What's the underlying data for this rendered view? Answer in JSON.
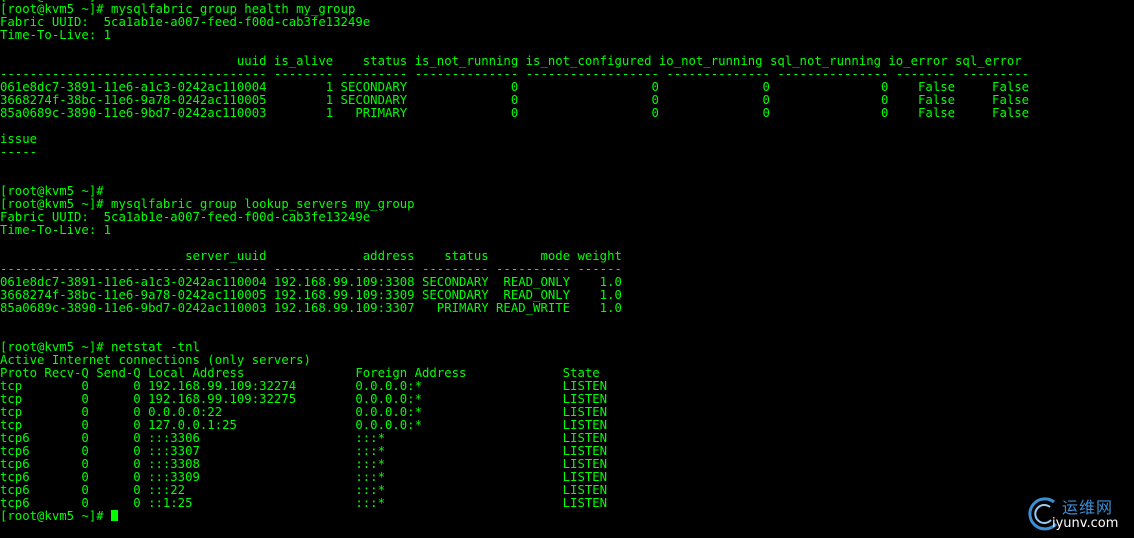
{
  "terminal": {
    "fg_color": "#00ff00",
    "bg_color": "#000000",
    "lines": [
      "[root@kvm5 ~]#",
      "[root@kvm5 ~]# mysqlfabric group health my_group",
      "Fabric UUID:  5ca1ab1e-a007-feed-f00d-cab3fe13249e",
      "Time-To-Live: 1",
      "",
      "                                uuid is_alive    status is_not_running is_not_configured io_not_running sql_not_running io_error sql_error",
      "------------------------------------ -------- --------- -------------- ------------------ -------------- --------------- -------- ---------",
      "061e8dc7-3891-11e6-a1c3-0242ac110004        1 SECONDARY              0                  0              0               0    False     False",
      "3668274f-38bc-11e6-9a78-0242ac110005        1 SECONDARY              0                  0              0               0    False     False",
      "85a0689c-3890-11e6-9bd7-0242ac110003        1   PRIMARY              0                  0              0               0    False     False",
      "",
      "issue",
      "-----",
      "",
      "",
      "[root@kvm5 ~]#",
      "[root@kvm5 ~]# mysqlfabric group lookup_servers my_group",
      "Fabric UUID:  5ca1ab1e-a007-feed-f00d-cab3fe13249e",
      "Time-To-Live: 1",
      "",
      "                         server_uuid             address    status       mode weight",
      "------------------------------------ ------------------- --------- ---------- ------",
      "061e8dc7-3891-11e6-a1c3-0242ac110004 192.168.99.109:3308 SECONDARY  READ_ONLY    1.0",
      "3668274f-38bc-11e6-9a78-0242ac110005 192.168.99.109:3309 SECONDARY  READ_ONLY    1.0",
      "85a0689c-3890-11e6-9bd7-0242ac110003 192.168.99.109:3307   PRIMARY READ_WRITE    1.0",
      "",
      "",
      "[root@kvm5 ~]# netstat -tnl",
      "Active Internet connections (only servers)",
      "Proto Recv-Q Send-Q Local Address               Foreign Address             State",
      "tcp        0      0 192.168.99.109:32274        0.0.0.0:*                   LISTEN",
      "tcp        0      0 192.168.99.109:32275        0.0.0.0:*                   LISTEN",
      "tcp        0      0 0.0.0.0:22                  0.0.0.0:*                   LISTEN",
      "tcp        0      0 127.0.0.1:25                0.0.0.0:*                   LISTEN",
      "tcp6       0      0 :::3306                     :::*                        LISTEN",
      "tcp6       0      0 :::3307                     :::*                        LISTEN",
      "tcp6       0      0 :::3308                     :::*                        LISTEN",
      "tcp6       0      0 :::3309                     :::*                        LISTEN",
      "tcp6       0      0 :::22                       :::*                        LISTEN",
      "tcp6       0      0 ::1:25                      :::*                        LISTEN"
    ],
    "prompt": "[root@kvm5 ~]# "
  },
  "watermark": {
    "text_cn": "运维网",
    "text_url": "iyunv.com",
    "accent_color": "#3a8fd6",
    "icon": "swirl-logo-icon"
  }
}
